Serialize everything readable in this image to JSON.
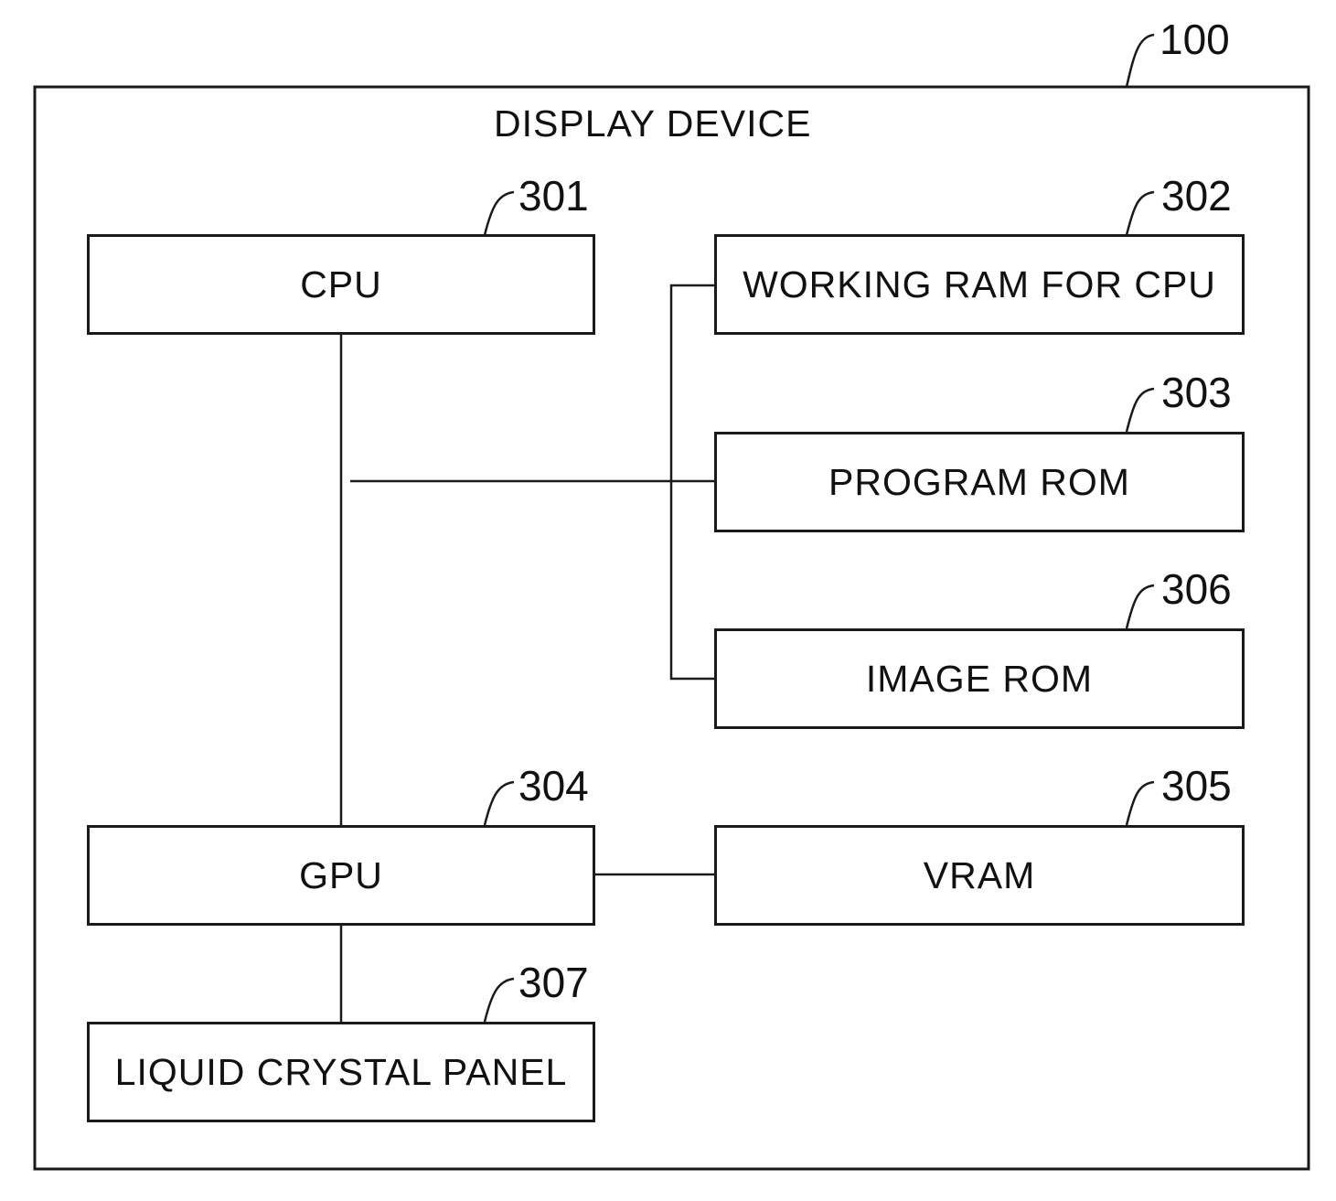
{
  "device": {
    "title": "DISPLAY DEVICE",
    "ref": "100"
  },
  "blocks": {
    "cpu": {
      "label": "CPU",
      "ref": "301"
    },
    "wram": {
      "label": "WORKING RAM FOR CPU",
      "ref": "302"
    },
    "prom": {
      "label": "PROGRAM ROM",
      "ref": "303"
    },
    "gpu": {
      "label": "GPU",
      "ref": "304"
    },
    "vram": {
      "label": "VRAM",
      "ref": "305"
    },
    "irom": {
      "label": "IMAGE ROM",
      "ref": "306"
    },
    "lcp": {
      "label": "LIQUID CRYSTAL PANEL",
      "ref": "307"
    }
  }
}
